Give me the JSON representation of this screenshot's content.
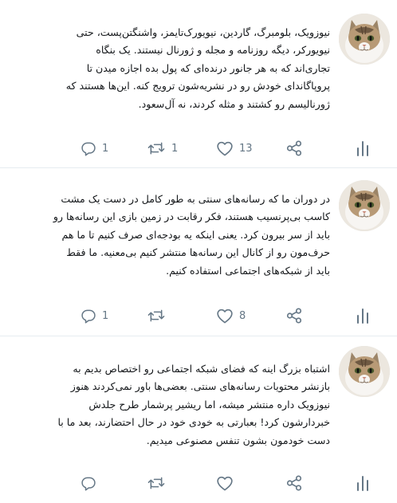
{
  "tweets": [
    {
      "text": "نیوزویک، بلومبرگ، گاردین، نیویورک‌تایمز، واشنگتن‌پست، حتی\nنیویورکر، دیگه روزنامه و مجله و ژورنال نیستند. یک بنگاه\nتجاری‌اند که به هر جانور درنده‌ای که پول بده اجازه میدن تا\nپروپاگاندای خودش رو در نشریه‌شون ترویج کنه. این‌ها هستند که\nژورنالیسم رو  کشتند و مثله کردند، نه آل‌سعود.",
      "replies": "1",
      "retweets": "1",
      "likes": "13"
    },
    {
      "text": "در دوران ما که رسانه‌های سنتی به طور کامل در دست  یک مشت\nکاسب بی‌پرنسیب هستند، فکر رقابت در زمین بازی این رسانه‌ها رو\nباید از سر بیرون کرد. یعنی اینکه یه بودجه‌ای صرف کنیم تا ما هم\nحرف‌مون رو از کانال این رسانه‌ها منتشر کنیم بی‌معنیه. ما فقط\nباید از شبکه‌های اجتماعی استفاده کنیم.",
      "replies": "1",
      "retweets": "",
      "likes": "8"
    },
    {
      "text": "اشتباه بزرگ اینه که فضای شبکه اجتماعی رو اختصاص بدیم به\nبازنشر محتویات رسانه‌های سنتی. بعضی‌ها باور نمی‌کردند هنوز\nنیوزویک داره منتشر میشه، اما ریشیر پرشمار طرح جلدش\nخبردارشون کرد! بعبارتی به خودی خود در حال احتضارند، بعد ما با\nدست خودمون بشون تنفس مصنوعی میدیم.",
      "replies": "",
      "retweets": "",
      "likes": ""
    }
  ],
  "colors": {
    "icon": "#657786",
    "divider": "#e6ecf0",
    "text": "#14171a"
  },
  "icons": [
    "reply-icon",
    "retweet-icon",
    "like-icon",
    "share-icon",
    "analytics-icon"
  ]
}
